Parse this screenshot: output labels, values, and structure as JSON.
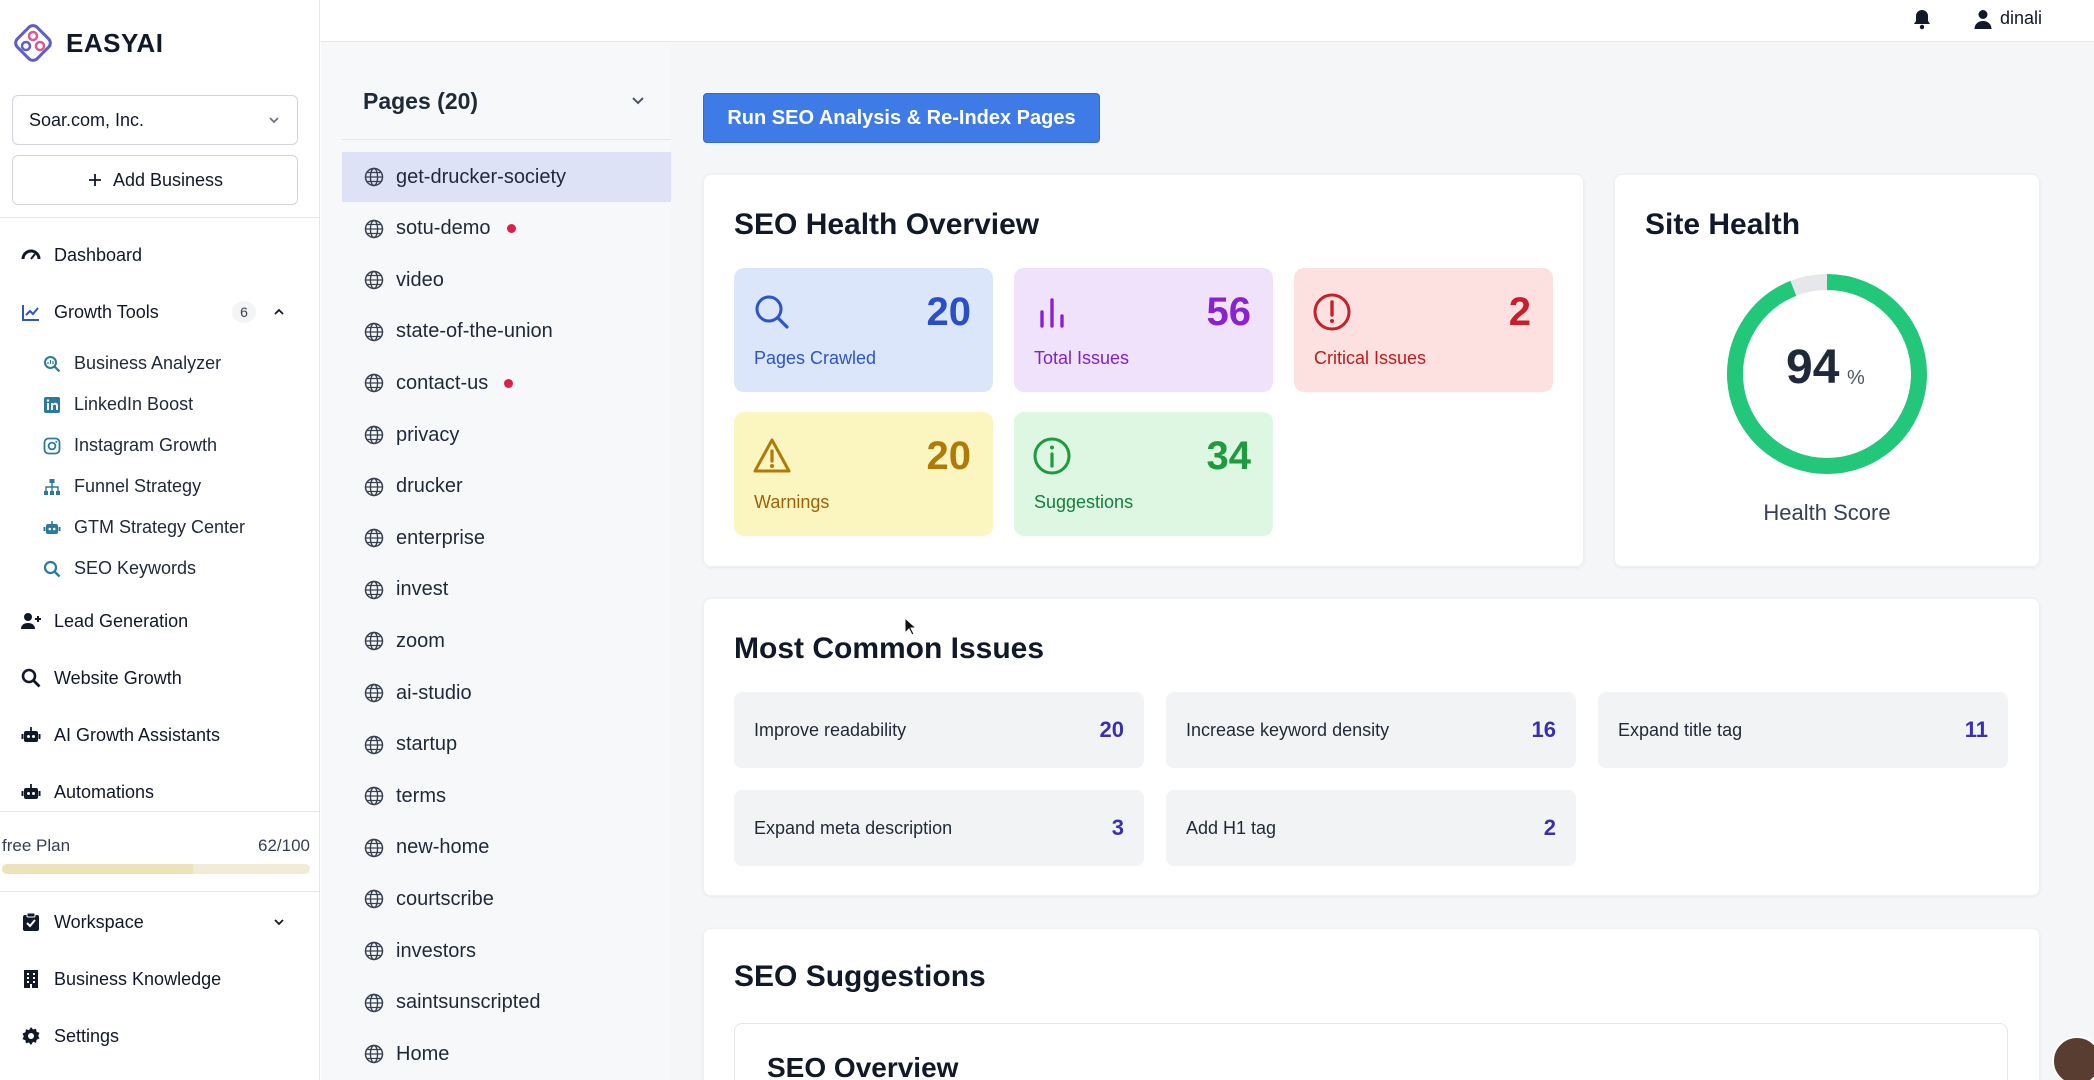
{
  "app": {
    "logo_text": "EASYAI"
  },
  "sidebar": {
    "business_select": "Soar.com, Inc.",
    "add_business": "Add Business",
    "nav": {
      "dashboard": "Dashboard",
      "growth_tools": "Growth Tools",
      "growth_tools_count": "6",
      "lead_generation": "Lead Generation",
      "website_growth": "Website Growth",
      "ai_growth_assistants": "AI Growth Assistants",
      "automations": "Automations",
      "workspace": "Workspace",
      "business_knowledge": "Business Knowledge",
      "settings": "Settings"
    },
    "growth_tools_items": [
      {
        "label": "Business Analyzer",
        "icon": "search-chart-icon"
      },
      {
        "label": "LinkedIn Boost",
        "icon": "linkedin-icon"
      },
      {
        "label": "Instagram Growth",
        "icon": "instagram-icon"
      },
      {
        "label": "Funnel Strategy",
        "icon": "sitemap-icon"
      },
      {
        "label": "GTM Strategy Center",
        "icon": "robot-icon"
      },
      {
        "label": "SEO Keywords",
        "icon": "search-icon"
      }
    ],
    "plan": {
      "label": "free Plan",
      "usage": "62/100",
      "used_fraction": 0.62
    }
  },
  "topbar": {
    "username": "dinali"
  },
  "pages_panel": {
    "title": "Pages (20)",
    "items": [
      {
        "label": "get-drucker-society",
        "active": true,
        "alert": false
      },
      {
        "label": "sotu-demo",
        "active": false,
        "alert": true
      },
      {
        "label": "video",
        "active": false,
        "alert": false
      },
      {
        "label": "state-of-the-union",
        "active": false,
        "alert": false
      },
      {
        "label": "contact-us",
        "active": false,
        "alert": true
      },
      {
        "label": "privacy",
        "active": false,
        "alert": false
      },
      {
        "label": "drucker",
        "active": false,
        "alert": false
      },
      {
        "label": "enterprise",
        "active": false,
        "alert": false
      },
      {
        "label": "invest",
        "active": false,
        "alert": false
      },
      {
        "label": "zoom",
        "active": false,
        "alert": false
      },
      {
        "label": "ai-studio",
        "active": false,
        "alert": false
      },
      {
        "label": "startup",
        "active": false,
        "alert": false
      },
      {
        "label": "terms",
        "active": false,
        "alert": false
      },
      {
        "label": "new-home",
        "active": false,
        "alert": false
      },
      {
        "label": "courtscribe",
        "active": false,
        "alert": false
      },
      {
        "label": "investors",
        "active": false,
        "alert": false
      },
      {
        "label": "saintsunscripted",
        "active": false,
        "alert": false
      },
      {
        "label": "Home",
        "active": false,
        "alert": false
      }
    ]
  },
  "main": {
    "run_button": "Run SEO Analysis & Re-Index Pages",
    "overview": {
      "title": "SEO Health Overview",
      "tiles": [
        {
          "label": "Pages Crawled",
          "value": "20",
          "icon": "search-icon",
          "bg": "#dbe6fb",
          "color": "#2a4fc4",
          "label_color": "#2b55c8"
        },
        {
          "label": "Total Issues",
          "value": "56",
          "icon": "bar-chart-icon",
          "bg": "#f1e2fb",
          "color": "#8a22cf",
          "label_color": "#7e22ce"
        },
        {
          "label": "Critical Issues",
          "value": "2",
          "icon": "alert-circle-icon",
          "bg": "#fde1e1",
          "color": "#c81e2b",
          "label_color": "#b91c1c"
        },
        {
          "label": "Warnings",
          "value": "20",
          "icon": "warning-triangle-icon",
          "bg": "#fbf5bf",
          "color": "#b07a08",
          "label_color": "#a16207"
        },
        {
          "label": "Suggestions",
          "value": "34",
          "icon": "info-circle-icon",
          "bg": "#ddf7e3",
          "color": "#1f9a3e",
          "label_color": "#15803d"
        }
      ]
    },
    "site_health": {
      "title": "Site Health",
      "score": "94",
      "score_unit": "%",
      "score_fraction": 0.94,
      "label": "Health Score",
      "ring_color": "#22c77a",
      "track_color": "#e5e7eb"
    },
    "common_issues": {
      "title": "Most Common Issues",
      "items": [
        {
          "label": "Improve readability",
          "count": "20"
        },
        {
          "label": "Increase keyword density",
          "count": "16"
        },
        {
          "label": "Expand title tag",
          "count": "11"
        },
        {
          "label": "Expand meta description",
          "count": "3"
        },
        {
          "label": "Add H1 tag",
          "count": "2"
        }
      ]
    },
    "suggestions": {
      "title": "SEO Suggestions",
      "overview_title": "SEO Overview"
    }
  },
  "colors": {
    "accent": "#3f7be6",
    "active_page_bg": "#dee2f7",
    "alert_dot": "#e11d48"
  }
}
